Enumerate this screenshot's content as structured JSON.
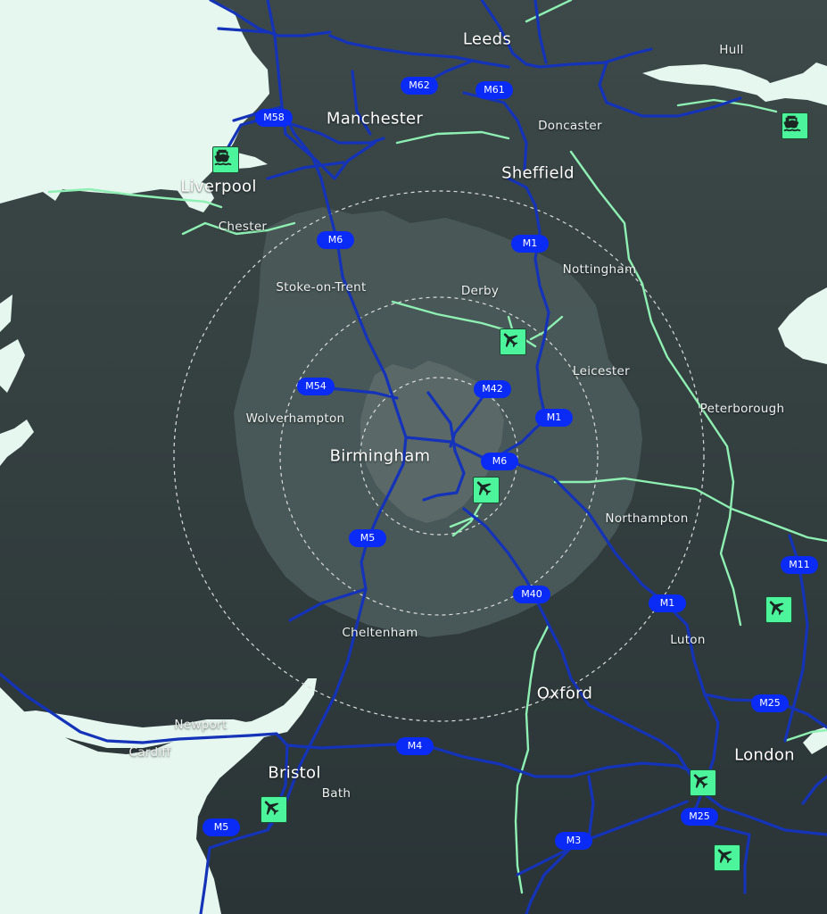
{
  "colors": {
    "sea": "#e6f7ef",
    "land": "#3c4848",
    "land_dark": "#2b3536",
    "midlands": "#4a5858",
    "core": "#5a6868",
    "motorway": "#1533b8",
    "motorway_badge": "#0a2bf5",
    "a_road": "#8ff0b4",
    "poi": "#4cf59c",
    "ring": "#d9dede"
  },
  "cities_major": [
    {
      "id": "leeds",
      "label": "Leeds"
    },
    {
      "id": "manchester",
      "label": "Manchester"
    },
    {
      "id": "sheffield",
      "label": "Sheffield"
    },
    {
      "id": "liverpool",
      "label": "Liverpool"
    },
    {
      "id": "birmingham",
      "label": "Birmingham"
    },
    {
      "id": "oxford",
      "label": "Oxford"
    },
    {
      "id": "bristol",
      "label": "Bristol"
    },
    {
      "id": "london",
      "label": "London"
    }
  ],
  "cities_minor": [
    {
      "id": "hull",
      "label": "Hull"
    },
    {
      "id": "doncaster",
      "label": "Doncaster"
    },
    {
      "id": "chester",
      "label": "Chester"
    },
    {
      "id": "nottingham",
      "label": "Nottingham"
    },
    {
      "id": "stoke",
      "label": "Stoke-on-Trent"
    },
    {
      "id": "derby",
      "label": "Derby"
    },
    {
      "id": "leicester",
      "label": "Leicester"
    },
    {
      "id": "wolverhampton",
      "label": "Wolverhampton"
    },
    {
      "id": "peterborough",
      "label": "Peterborough"
    },
    {
      "id": "northampton",
      "label": "Northampton"
    },
    {
      "id": "cheltenham",
      "label": "Cheltenham"
    },
    {
      "id": "luton",
      "label": "Luton"
    },
    {
      "id": "newport",
      "label": "Newport"
    },
    {
      "id": "cardiff",
      "label": "Cardiff"
    },
    {
      "id": "bath",
      "label": "Bath"
    }
  ],
  "motorways": [
    {
      "id": "m62",
      "label": "M62"
    },
    {
      "id": "m61",
      "label": "M61"
    },
    {
      "id": "m58",
      "label": "M58"
    },
    {
      "id": "m6-north",
      "label": "M6"
    },
    {
      "id": "m1-north",
      "label": "M1"
    },
    {
      "id": "m54",
      "label": "M54"
    },
    {
      "id": "m42",
      "label": "M42"
    },
    {
      "id": "m1-mid",
      "label": "M1"
    },
    {
      "id": "m6-mid",
      "label": "M6"
    },
    {
      "id": "m5-mid",
      "label": "M5"
    },
    {
      "id": "m11",
      "label": "M11"
    },
    {
      "id": "m40",
      "label": "M40"
    },
    {
      "id": "m1-south",
      "label": "M1"
    },
    {
      "id": "m25-north",
      "label": "M25"
    },
    {
      "id": "m4",
      "label": "M4"
    },
    {
      "id": "m25-south",
      "label": "M25"
    },
    {
      "id": "m5-south",
      "label": "M5"
    },
    {
      "id": "m3",
      "label": "M3"
    }
  ],
  "pois": [
    {
      "id": "port-liverpool",
      "icon": "ship-icon"
    },
    {
      "id": "port-hull",
      "icon": "ship-icon"
    },
    {
      "id": "airport-east-midlands",
      "icon": "airplane-icon"
    },
    {
      "id": "airport-birmingham",
      "icon": "airplane-icon"
    },
    {
      "id": "airport-stansted",
      "icon": "airplane-icon"
    },
    {
      "id": "airport-luton",
      "icon": "airplane-icon"
    },
    {
      "id": "airport-heathrow",
      "icon": "airplane-icon"
    },
    {
      "id": "airport-bristol",
      "icon": "airplane-icon"
    },
    {
      "id": "airport-gatwick",
      "icon": "airplane-icon"
    }
  ]
}
